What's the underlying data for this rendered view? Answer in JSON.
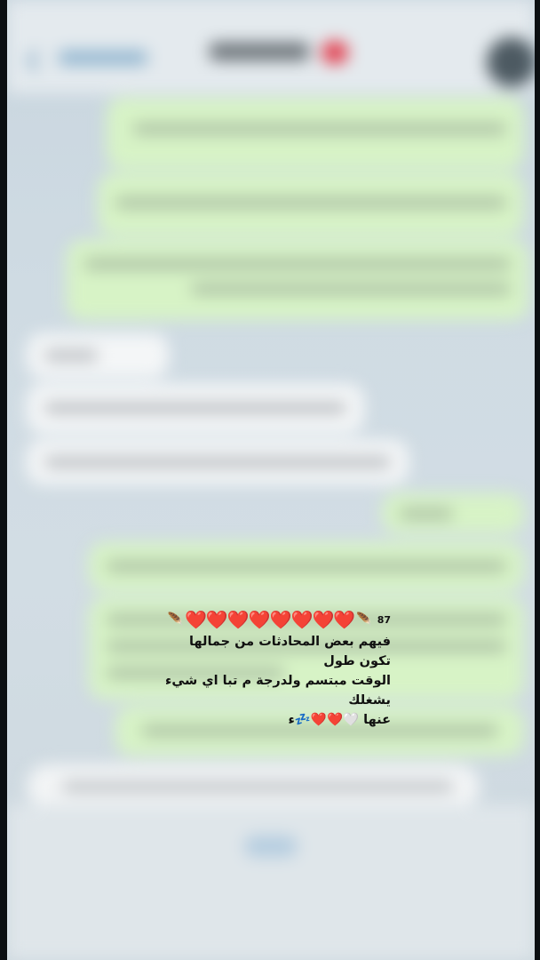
{
  "caption": {
    "count": "87",
    "feather_left": "🪶",
    "hearts": "❤️❤️❤️❤️❤️❤️❤️❤️",
    "feather_right": "🪶",
    "text": "فيهم بعض المحادثات من جمالها تكون طول\nالوقت مبتسم ولدرجة م تبا اي شيء يشغلك\nعنها 🤍❤️❤️💤ء"
  },
  "colors": {
    "outgoing_bubble": "#d7f3c6",
    "incoming_bubble": "#f4f6f7",
    "background": "#cfdbe3",
    "accent": "#5e8fb5"
  },
  "icons": {
    "back": "chevron-left-icon",
    "avatar": "avatar",
    "badge": "heart-icon"
  }
}
